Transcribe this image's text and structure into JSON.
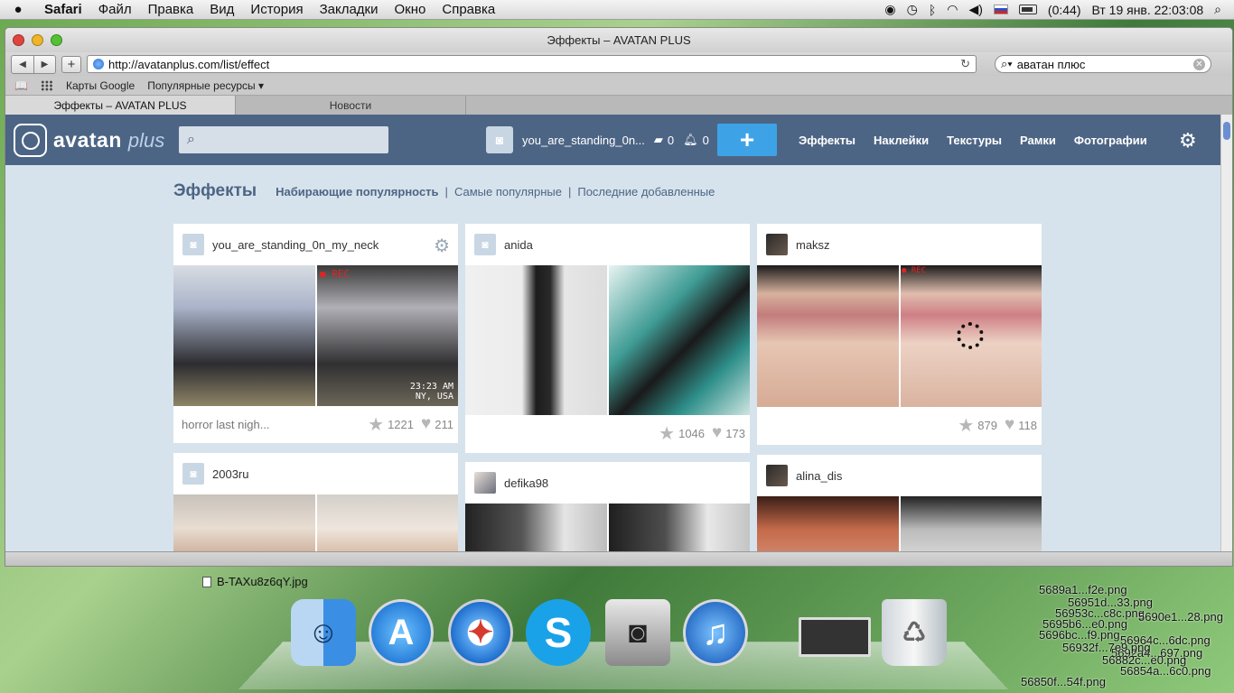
{
  "menubar": {
    "apple": "",
    "items": [
      "Safari",
      "Файл",
      "Правка",
      "Вид",
      "История",
      "Закладки",
      "Окно",
      "Справка"
    ],
    "battery": "(0:44)",
    "clock": "Вт 19 янв.  22:03:08"
  },
  "window": {
    "title": "Эффекты – AVATAN PLUS"
  },
  "toolbar": {
    "url": "http://avatanplus.com/list/effect",
    "search_value": "аватан плюс"
  },
  "bookmarks": [
    "Карты Google",
    "Популярные ресурсы ▾"
  ],
  "tabs": [
    "Эффекты – AVATAN PLUS",
    "Новости"
  ],
  "avatan": {
    "logo_main": "avatan",
    "logo_plus": "plus",
    "username": "you_are_standing_0n...",
    "comments_count": "0",
    "notifications_count": "0",
    "add_label": "+",
    "nav": [
      "Эффекты",
      "Наклейки",
      "Текстуры",
      "Рамки",
      "Фотографии"
    ]
  },
  "subnav": {
    "heading": "Эффекты",
    "links": [
      "Набирающие популярность",
      "Самые популярные",
      "Последние добавленные"
    ],
    "separator": "|"
  },
  "cards": [
    {
      "user": "you_are_standing_0n_my_neck",
      "desc": "horror last nigh...",
      "stars": "1221",
      "likes": "211",
      "overlay_time": "23:23 AM",
      "overlay_place": "NY, USA",
      "rec": "● REC"
    },
    {
      "user": "anida",
      "desc": "",
      "stars": "1046",
      "likes": "173"
    },
    {
      "user": "maksz",
      "desc": "",
      "stars": "879",
      "likes": "118",
      "rec": "● REC"
    },
    {
      "user": "2003ru"
    },
    {
      "user": "defika98"
    },
    {
      "user": "alina_dis"
    }
  ],
  "desktop": {
    "file_left": "B-TAXu8z6qY.jpg",
    "files_right": [
      "5689a1...f2e.png",
      "56951d...33.png",
      "56953c...c8c.png",
      "5690e1...28.png",
      "5695b6...e0.png",
      "5696bc...f9.png",
      "56964c...6dc.png",
      "5692a4...697.png",
      "56932f...7e9.png",
      "56850f...54f.png",
      "56854a...6c0.png",
      "56882c...e0.png"
    ]
  },
  "dock": [
    "Finder",
    "App Store",
    "Safari",
    "Skype",
    "Image Capture",
    "iTunes",
    "Preview",
    "Trash"
  ]
}
